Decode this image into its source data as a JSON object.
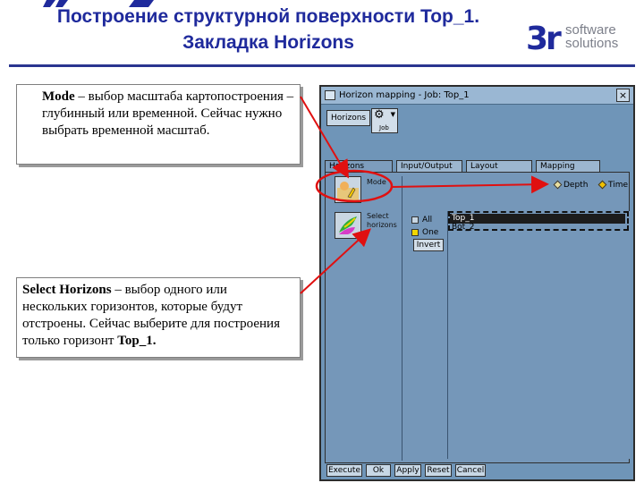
{
  "slide": {
    "title_line1": "Построение структурной поверхности Top_1.",
    "title_line2": "Закладка Horizons",
    "logo": {
      "mark": "3r",
      "line1": "software",
      "line2": "solutions"
    }
  },
  "callouts": {
    "mode": {
      "term": "Mode",
      "text": " – выбор масштаба картопостроения – глубинный или временной. Сейчас нужно выбрать временной масштаб."
    },
    "select": {
      "term": "Select Horizons",
      "text": " – выбор одного или нескольких горизонтов, которые будут отстроены. Сейчас выберите для построения только горизонт ",
      "term2": "Top_1."
    }
  },
  "window": {
    "title": "Horizon mapping - Job: Top_1",
    "close": "×",
    "toolbar": {
      "horizons_button": "Horizons",
      "job_button": "Job"
    },
    "tabs": [
      "Horizons",
      "Input/Output",
      "Layout",
      "Mapping"
    ],
    "mode": {
      "label": "Mode",
      "options": [
        "Depth",
        "Time"
      ],
      "selected": "Time"
    },
    "select_horizons": {
      "label_line1": "Select",
      "label_line2": "horizons",
      "check_all": "All",
      "check_one": "One",
      "invert": "Invert",
      "horizons": [
        "Top_1",
        "Bot_2"
      ],
      "selected": "Top_1"
    },
    "buttons": [
      "Execute",
      "Ok",
      "Apply",
      "Reset",
      "Cancel"
    ]
  },
  "colors": {
    "title": "#1f2a9c",
    "arrow": "#e01010",
    "window_bg": "#7597b9"
  }
}
